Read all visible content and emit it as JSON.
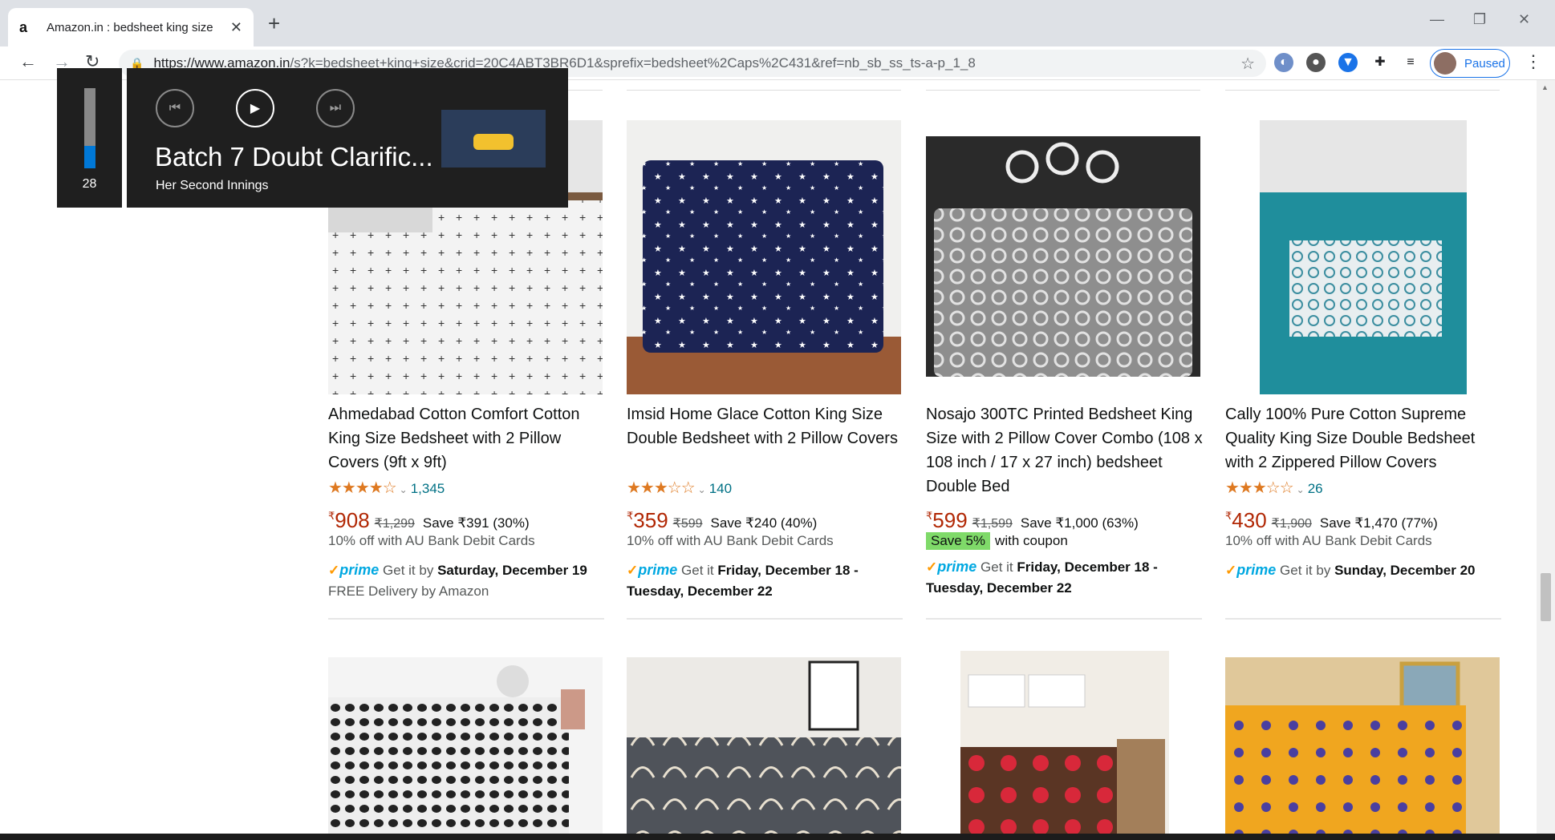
{
  "browser": {
    "tab_title": "Amazon.in : bedsheet king size",
    "tab_favicon": "a",
    "new_tab": "+",
    "url_host": "https://www.amazon.in",
    "url_path": "/s?k=bedsheet+king+size&crid=20C4ABT3BR6D1&sprefix=bedsheet%2Caps%2C431&ref=nb_sb_ss_ts-a-p_1_8",
    "profile_label": "Paused"
  },
  "media_overlay": {
    "volume": "28",
    "volume_level": 0.28,
    "title": "Batch 7 Doubt Clarific...",
    "artist": "Her Second Innings"
  },
  "products": [
    {
      "name": "Ahmedabad Cotton Comfort Cotton King Size Bedsheet with 2 Pillow Covers (9ft x 9ft)",
      "stars": "★★★★☆",
      "rating_value": 4.0,
      "reviews": "1,345",
      "currency": "₹",
      "price": "908",
      "mrp": "₹1,299",
      "save": "Save ₹391 (30%)",
      "offer": "10% off with AU Bank Debit Cards",
      "prime": "prime",
      "delivery_prefix": "Get it by",
      "delivery_date": "Saturday, December 19",
      "delivery_note": "FREE Delivery by Amazon"
    },
    {
      "name": "Imsid Home Glace Cotton King Size Double Bedsheet with 2 Pillow Covers",
      "stars": "★★★☆☆",
      "rating_value": 3.0,
      "reviews": "140",
      "currency": "₹",
      "price": "359",
      "mrp": "₹599",
      "save": "Save ₹240 (40%)",
      "offer": "10% off with AU Bank Debit Cards",
      "prime": "prime",
      "delivery_prefix": "Get it",
      "delivery_date": "Friday, December 18 - Tuesday, December 22",
      "delivery_note": ""
    },
    {
      "name": "Nosajo 300TC Printed Bedsheet King Size with 2 Pillow Cover Combo (108 x 108 inch / 17 x 27 inch) bedsheet Double Bed",
      "stars": "",
      "rating_value": null,
      "reviews": "",
      "currency": "₹",
      "price": "599",
      "mrp": "₹1,599",
      "save": "Save ₹1,000 (63%)",
      "offer": "",
      "coupon_badge": "Save 5%",
      "coupon_text": "with coupon",
      "prime": "prime",
      "delivery_prefix": "Get it",
      "delivery_date": "Friday, December 18 - Tuesday, December 22",
      "delivery_note": ""
    },
    {
      "name": "Cally 100% Pure Cotton Supreme Quality King Size Double Bedsheet with 2 Zippered Pillow Covers",
      "stars": "★★★☆☆",
      "rating_value": 3.0,
      "reviews": "26",
      "currency": "₹",
      "price": "430",
      "mrp": "₹1,900",
      "save": "Save ₹1,470 (77%)",
      "offer": "10% off with AU Bank Debit Cards",
      "prime": "prime",
      "delivery_prefix": "Get it by",
      "delivery_date": "Sunday, December 20",
      "delivery_note": ""
    }
  ],
  "colors": {
    "price_red": "#b12704",
    "link_teal": "#007185",
    "star_orange": "#de7921",
    "prime_blue": "#00a8e1",
    "coupon_green": "#7fda69"
  }
}
